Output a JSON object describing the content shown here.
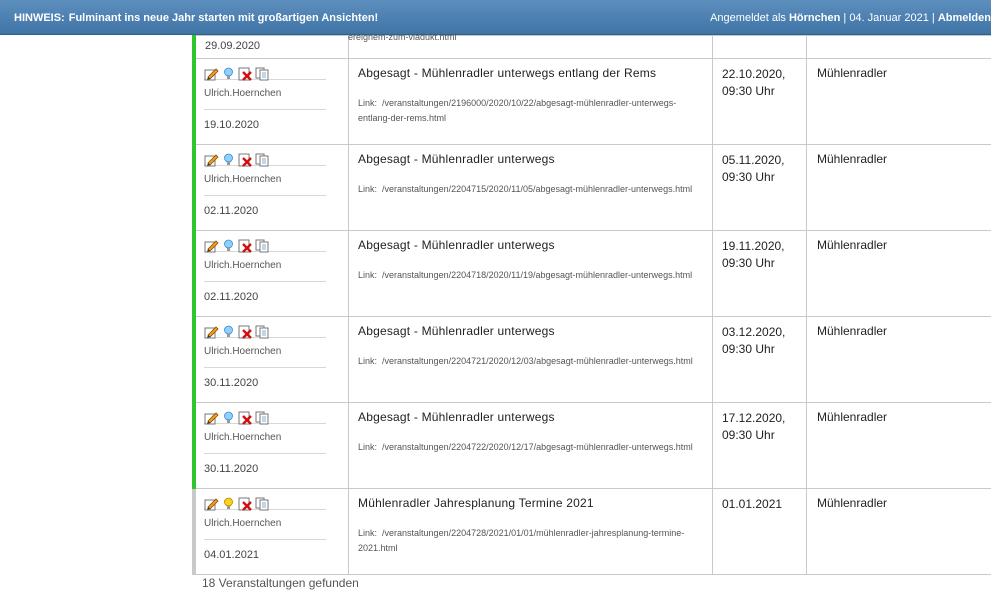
{
  "header": {
    "notice_label": "HINWEIS:",
    "notice_text": "Fulminant ins neue Jahr starten mit großartigen Ansichten!",
    "logged_in_prefix": "Angemeldet als",
    "username": "Hörnchen",
    "separator": "|",
    "current_date": "04. Januar 2021",
    "logout_label": "Abmelden"
  },
  "partial_row": {
    "date": "29.09.2020",
    "link_fragment": "ereignem-zum-viadukt.html"
  },
  "rows": [
    {
      "author": "Ulrich.Hoernchen",
      "created": "19.10.2020",
      "title": "Abgesagt - Mühlenradler unterwegs entlang der Rems",
      "link_label": "Link:",
      "link_url": "/veranstaltungen/2196000/2020/10/22/abgesagt-mühlenradler-unterwegs-entlang-der-rems.html",
      "date_line1": "22.10.2020,",
      "date_line2": "09:30 Uhr",
      "organizer": "Mühlenradler",
      "status_color": "#2ec52e"
    },
    {
      "author": "Ulrich.Hoernchen",
      "created": "02.11.2020",
      "title": "Abgesagt - Mühlenradler unterwegs",
      "link_label": "Link:",
      "link_url": "/veranstaltungen/2204715/2020/11/05/abgesagt-mühlenradler-unterwegs.html",
      "date_line1": "05.11.2020,",
      "date_line2": "09:30 Uhr",
      "organizer": "Mühlenradler",
      "status_color": "#2ec52e"
    },
    {
      "author": "Ulrich.Hoernchen",
      "created": "02.11.2020",
      "title": "Abgesagt - Mühlenradler unterwegs",
      "link_label": "Link:",
      "link_url": "/veranstaltungen/2204718/2020/11/19/abgesagt-mühlenradler-unterwegs.html",
      "date_line1": "19.11.2020,",
      "date_line2": "09:30 Uhr",
      "organizer": "Mühlenradler",
      "status_color": "#2ec52e"
    },
    {
      "author": "Ulrich.Hoernchen",
      "created": "30.11.2020",
      "title": "Abgesagt - Mühlenradler unterwegs",
      "link_label": "Link:",
      "link_url": "/veranstaltungen/2204721/2020/12/03/abgesagt-mühlenradler-unterwegs.html",
      "date_line1": "03.12.2020,",
      "date_line2": "09:30 Uhr",
      "organizer": "Mühlenradler",
      "status_color": "#2ec52e"
    },
    {
      "author": "Ulrich.Hoernchen",
      "created": "30.11.2020",
      "title": "Abgesagt - Mühlenradler unterwegs",
      "link_label": "Link:",
      "link_url": "/veranstaltungen/2204722/2020/12/17/abgesagt-mühlenradler-unterwegs.html",
      "date_line1": "17.12.2020,",
      "date_line2": "09:30 Uhr",
      "organizer": "Mühlenradler",
      "status_color": "#2ec52e"
    },
    {
      "author": "Ulrich.Hoernchen",
      "created": "04.01.2021",
      "title": "Mühlenradler Jahresplanung Termine 2021",
      "link_label": "Link:",
      "link_url": "/veranstaltungen/2204728/2021/01/01/mühlenradler-jahresplanung-termine-2021.html",
      "date_line1": "01.01.2021",
      "date_line2": "",
      "organizer": "Mühlenradler",
      "status_color": "#c9c9c9"
    }
  ],
  "icons": [
    "edit-icon",
    "lightbulb-icon",
    "delete-icon",
    "copy-icon"
  ],
  "footer": {
    "text": "18 Veranstaltungen gefunden"
  }
}
